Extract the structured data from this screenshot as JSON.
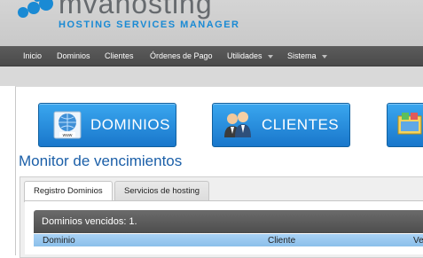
{
  "brand": {
    "name": "mvahosting",
    "tagline": "HOSTING SERVICES MANAGER",
    "dot_color": "#1a8ad4"
  },
  "nav": {
    "items": [
      {
        "label": "Inicio"
      },
      {
        "label": "Dominios"
      },
      {
        "label": "Clientes"
      },
      {
        "label": "Órdenes de Pago"
      },
      {
        "label": "Utilidades",
        "dropdown": true
      },
      {
        "label": "Sistema",
        "dropdown": true
      }
    ]
  },
  "shortcuts": [
    {
      "label": "DOMINIOS",
      "icon": "globe-www-icon"
    },
    {
      "label": "CLIENTES",
      "icon": "users-icon"
    },
    {
      "label": "",
      "icon": "app-window-icon"
    }
  ],
  "page_title": "Monitor de vencimientos",
  "tabs": [
    {
      "label": "Registro Dominios",
      "active": true
    },
    {
      "label": "Servicios de hosting",
      "active": false
    }
  ],
  "table": {
    "banner": "Dominios vencidos: 1.",
    "columns": [
      "Dominio",
      "Cliente",
      "Ve"
    ]
  },
  "colors": {
    "accent": "#1b5fa8",
    "button": "#2a8fe0",
    "nav_bg": "#4f4f4f"
  }
}
